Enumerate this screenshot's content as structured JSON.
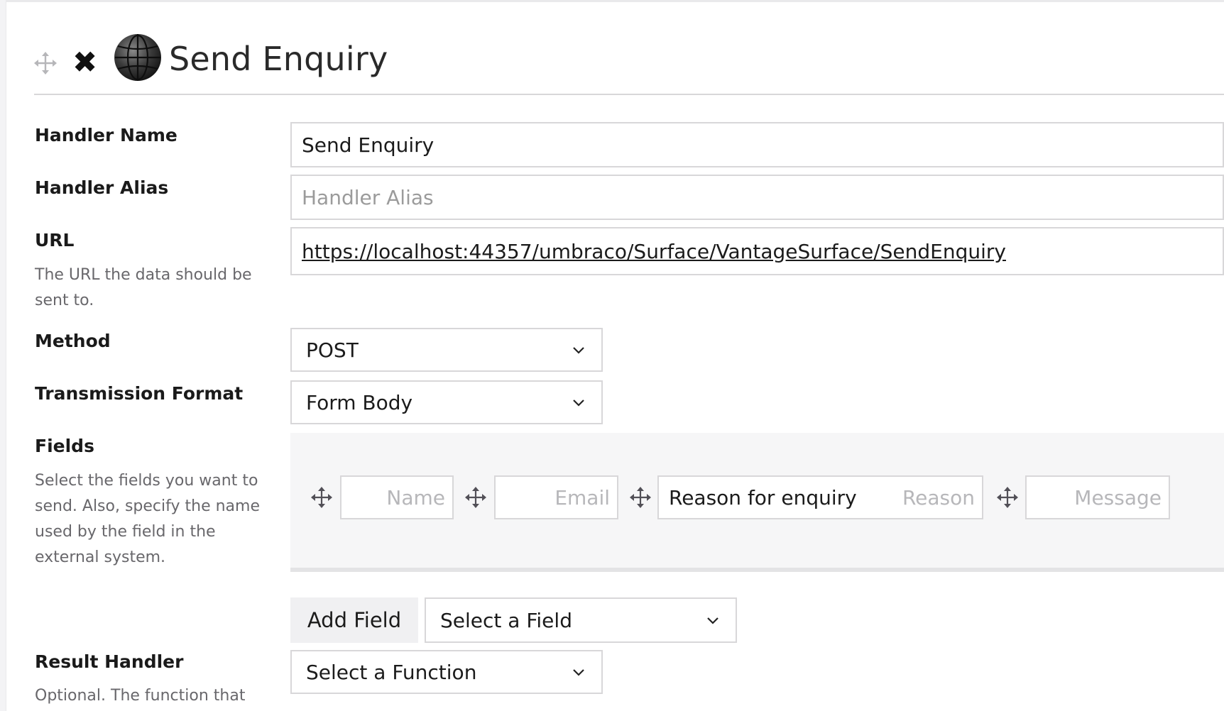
{
  "header": {
    "title": "Send Enquiry",
    "move_icon": "move-icon",
    "close_icon": "close-icon",
    "close_glyph": "✖",
    "handler_icon": "globe-icon"
  },
  "form": {
    "handler_name": {
      "label": "Handler Name",
      "value": "Send Enquiry"
    },
    "handler_alias": {
      "label": "Handler Alias",
      "placeholder": "Handler Alias"
    },
    "url": {
      "label": "URL",
      "description": "The URL the data should be sent to.",
      "value": "https://localhost:44357/umbraco/Surface/VantageSurface/SendEnquiry"
    },
    "method": {
      "label": "Method",
      "selected": "POST"
    },
    "transmission_format": {
      "label": "Transmission Format",
      "selected": "Form Body"
    },
    "fields": {
      "label": "Fields",
      "description": "Select the fields you want to send. Also, specify the name used by the field in the external system.",
      "items": [
        {
          "value": "",
          "placeholder": "Name"
        },
        {
          "value": "",
          "placeholder": "Email"
        },
        {
          "value": "Reason for enquiry",
          "placeholder": "Reason"
        },
        {
          "value": "",
          "placeholder": "Message"
        }
      ],
      "add_button": "Add Field",
      "select_field": "Select a Field"
    },
    "result_handler": {
      "label": "Result Handler",
      "description": "Optional. The function that",
      "selected": "Select a Function"
    }
  },
  "colors": {
    "border": "#d8d7d9",
    "label": "#1a1a1a",
    "desc": "#68676b",
    "fields_bg": "#f6f6f7"
  }
}
